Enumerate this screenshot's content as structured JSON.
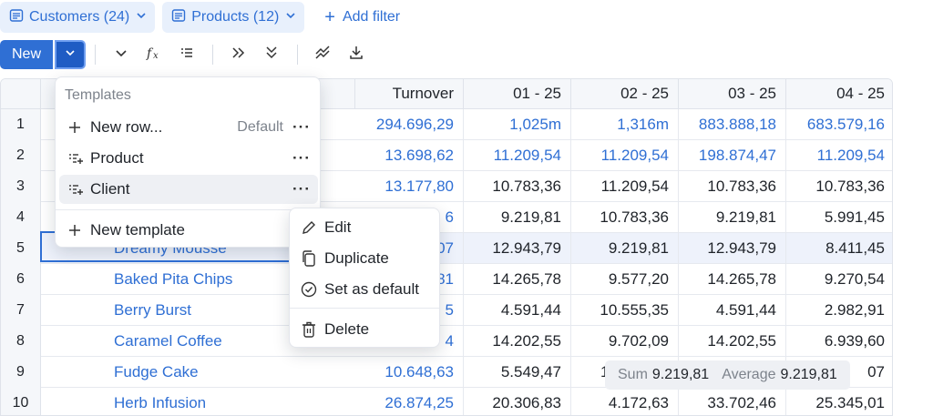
{
  "filters": [
    {
      "label": "Customers (24)",
      "icon": "list-icon"
    },
    {
      "label": "Products (12)",
      "icon": "list-icon"
    }
  ],
  "add_filter": "Add filter",
  "toolbar": {
    "new_label": "New",
    "icons": [
      "chevron-down-icon",
      "formula-icon",
      "list-view-icon",
      "expand-right-icon",
      "expand-down-icon",
      "trend-icon",
      "download-icon"
    ]
  },
  "grid": {
    "columns": [
      "Turnover",
      "01 - 25",
      "02 - 25",
      "03 - 25",
      "04 - 25"
    ],
    "rows": [
      {
        "num": "1",
        "name": "",
        "values": [
          "294.696,29",
          "1,025m",
          "1,316m",
          "883.888,18",
          "683.579,16"
        ],
        "link_values": true
      },
      {
        "num": "2",
        "name": "",
        "values": [
          "13.698,62",
          "11.209,54",
          "11.209,54",
          "198.874,47",
          "11.209,54"
        ],
        "link_values": true
      },
      {
        "num": "3",
        "name": "",
        "values": [
          "13.177,80",
          "10.783,36",
          "11.209,54",
          "10.783,36",
          "10.783,36"
        ],
        "link_values": false
      },
      {
        "num": "4",
        "name": "",
        "values": [
          "6",
          "9.219,81",
          "10.783,36",
          "9.219,81",
          "5.991,45"
        ],
        "link_values": false
      },
      {
        "num": "5",
        "name": "Dreamy Mousse",
        "values": [
          "07",
          "12.943,79",
          "9.219,81",
          "12.943,79",
          "8.411,45"
        ],
        "link_values": false
      },
      {
        "num": "6",
        "name": "Baked Pita Chips",
        "values": [
          "81",
          "14.265,78",
          "9.577,20",
          "14.265,78",
          "9.270,54"
        ],
        "link_values": false
      },
      {
        "num": "7",
        "name": "Berry Burst",
        "values": [
          "5",
          "4.591,44",
          "10.555,35",
          "4.591,44",
          "2.982,91"
        ],
        "link_values": false
      },
      {
        "num": "8",
        "name": "Caramel Coffee",
        "values": [
          "4",
          "14.202,55",
          "9.702,09",
          "14.202,55",
          "6.939,60"
        ],
        "link_values": false
      },
      {
        "num": "9",
        "name": "Fudge Cake",
        "values": [
          "10.648,63",
          "5.549,47",
          "1",
          "",
          "07"
        ],
        "link_values": false
      },
      {
        "num": "10",
        "name": "Herb Infusion",
        "values": [
          "26.874,25",
          "20.306,83",
          "4.172,63",
          "33.702,46",
          "25.345,01"
        ],
        "link_values": false
      }
    ]
  },
  "templates_menu": {
    "header": "Templates",
    "items": [
      {
        "label": "New row...",
        "default": "Default",
        "icon": "plus-icon"
      },
      {
        "label": "Product",
        "default": "",
        "icon": "template-icon"
      },
      {
        "label": "Client",
        "default": "",
        "icon": "template-icon"
      }
    ],
    "new_template": "New template"
  },
  "context_menu": {
    "items": [
      {
        "label": "Edit",
        "icon": "pencil-icon"
      },
      {
        "label": "Duplicate",
        "icon": "copy-icon"
      },
      {
        "label": "Set as default",
        "icon": "check-circle-icon"
      },
      {
        "label": "Delete",
        "icon": "trash-icon"
      }
    ]
  },
  "summary": {
    "sum_label": "Sum",
    "sum_value": "9.219,81",
    "avg_label": "Average",
    "avg_value": "9.219,81"
  },
  "colors": {
    "accent": "#2f6fd4",
    "chip_bg": "#e8f0fc",
    "header_bg": "#f5f7fa"
  }
}
